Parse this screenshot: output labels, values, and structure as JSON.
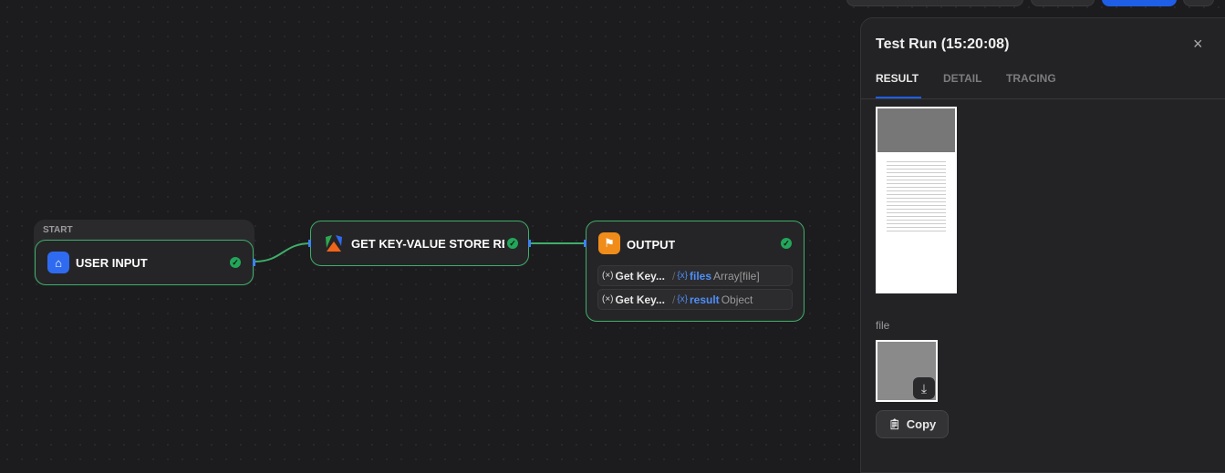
{
  "canvas": {
    "start_group": {
      "label": "START"
    },
    "nodes": [
      {
        "title": "USER INPUT",
        "icon": "home-icon",
        "icon_color": "#2f6bf0",
        "status": "success"
      },
      {
        "title": "GET KEY-VALUE STORE RE",
        "icon": "apify-logo-icon",
        "status": "success"
      },
      {
        "title": "OUTPUT",
        "icon": "flag-icon",
        "icon_color": "#f08c1a",
        "status": "success",
        "outputs": [
          {
            "var_icon": "(×)",
            "source": "Get Key...",
            "sep": "/",
            "field_icon": "{x}",
            "field": "files",
            "type": "Array[file]"
          },
          {
            "var_icon": "(×)",
            "source": "Get Key...",
            "sep": "/",
            "field_icon": "{x}",
            "field": "result",
            "type": "Object"
          }
        ]
      }
    ]
  },
  "panel": {
    "title": "Test Run (15:20:08)",
    "close": "×",
    "tabs": [
      {
        "label": "RESULT",
        "active": true
      },
      {
        "label": "DETAIL"
      },
      {
        "label": "TRACING"
      }
    ],
    "file_label": "file",
    "copy_label": "Copy"
  },
  "colors": {
    "accent": "#1f5fe8",
    "success": "#22a65a",
    "edge": "#3fae6a"
  }
}
